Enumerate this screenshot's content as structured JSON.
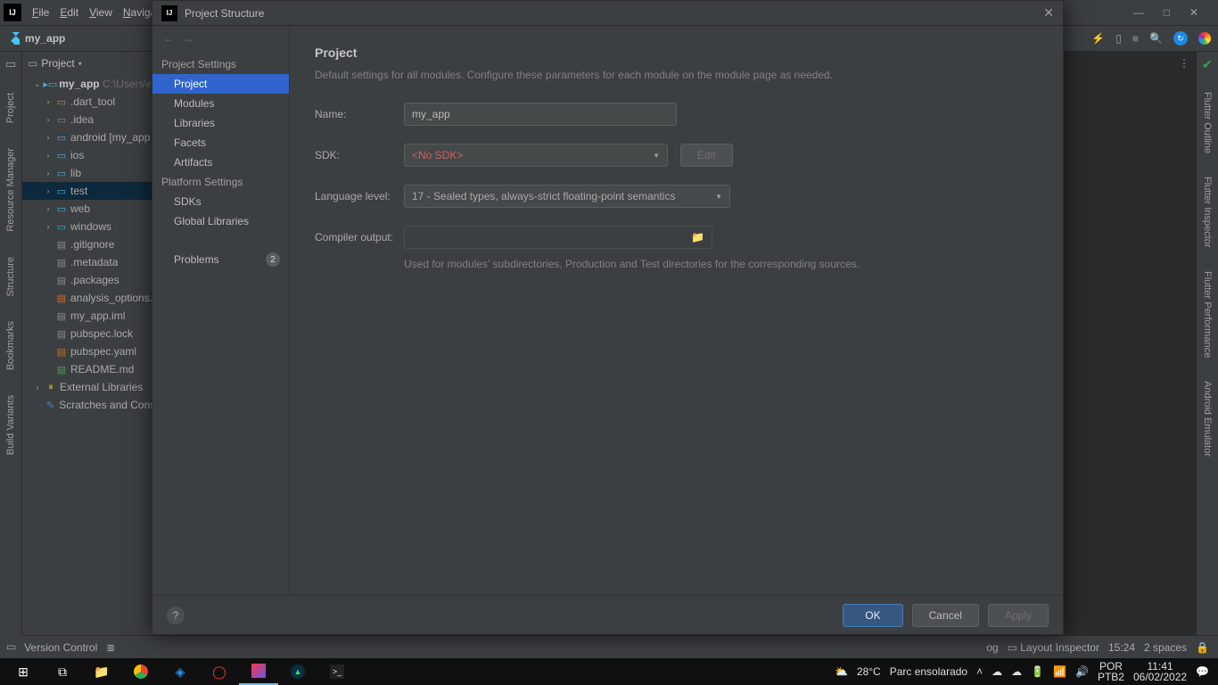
{
  "menubar": {
    "items": [
      "File",
      "Edit",
      "View",
      "Naviga"
    ]
  },
  "win_controls": {
    "min": "—",
    "max": "□",
    "close": "✕"
  },
  "breadcrumb": {
    "project": "my_app"
  },
  "topbar_icons": {
    "bolt": "⚡",
    "phone": "📱",
    "stop": "■",
    "search": "🔍"
  },
  "leftstrip": {
    "tabs": [
      "Project",
      "Resource Manager",
      "Structure",
      "Bookmarks",
      "Build Variants"
    ]
  },
  "rightstrip": {
    "tabs": [
      "Flutter Outline",
      "Flutter Inspector",
      "Flutter Performance",
      "Android Emulator"
    ]
  },
  "project_panel": {
    "title": "Project",
    "root": {
      "name": "my_app",
      "path": "C:\\Users\\en"
    },
    "tree": [
      {
        "indent": 1,
        "arrow": "⌄",
        "icon": "folder-root",
        "label": "my_app",
        "path": " C:\\Users\\en",
        "bold": true
      },
      {
        "indent": 2,
        "arrow": "›",
        "icon": "folder-orange",
        "label": ".dart_tool"
      },
      {
        "indent": 2,
        "arrow": "›",
        "icon": "folder-gray",
        "label": ".idea"
      },
      {
        "indent": 2,
        "arrow": "›",
        "icon": "folder-blue",
        "label": "android [my_app"
      },
      {
        "indent": 2,
        "arrow": "›",
        "icon": "folder-blue",
        "label": "ios"
      },
      {
        "indent": 2,
        "arrow": "›",
        "icon": "folder-blue",
        "label": "lib"
      },
      {
        "indent": 2,
        "arrow": "›",
        "icon": "folder-blue",
        "label": "test",
        "selected": true
      },
      {
        "indent": 2,
        "arrow": "›",
        "icon": "folder-blue",
        "label": "web"
      },
      {
        "indent": 2,
        "arrow": "›",
        "icon": "folder-blue",
        "label": "windows"
      },
      {
        "indent": 2,
        "arrow": "",
        "icon": "file",
        "label": ".gitignore"
      },
      {
        "indent": 2,
        "arrow": "",
        "icon": "file",
        "label": ".metadata"
      },
      {
        "indent": 2,
        "arrow": "",
        "icon": "file",
        "label": ".packages"
      },
      {
        "indent": 2,
        "arrow": "",
        "icon": "file-yaml",
        "label": "analysis_options."
      },
      {
        "indent": 2,
        "arrow": "",
        "icon": "file",
        "label": "my_app.iml"
      },
      {
        "indent": 2,
        "arrow": "",
        "icon": "file",
        "label": "pubspec.lock"
      },
      {
        "indent": 2,
        "arrow": "",
        "icon": "file-yaml",
        "label": "pubspec.yaml"
      },
      {
        "indent": 2,
        "arrow": "",
        "icon": "file-md",
        "label": "README.md"
      },
      {
        "indent": 1,
        "arrow": "›",
        "icon": "lib",
        "label": "External Libraries"
      },
      {
        "indent": 1,
        "arrow": "",
        "icon": "scratch",
        "label": "Scratches and Cons"
      }
    ]
  },
  "dialog": {
    "title": "Project Structure",
    "nav_sections": [
      {
        "title": "Project Settings",
        "items": [
          {
            "label": "Project",
            "selected": true
          },
          {
            "label": "Modules"
          },
          {
            "label": "Libraries"
          },
          {
            "label": "Facets"
          },
          {
            "label": "Artifacts"
          }
        ]
      },
      {
        "title": "Platform Settings",
        "items": [
          {
            "label": "SDKs"
          },
          {
            "label": "Global Libraries"
          }
        ]
      }
    ],
    "problems": {
      "label": "Problems",
      "count": "2"
    },
    "content": {
      "heading": "Project",
      "description": "Default settings for all modules. Configure these parameters for each module on the module page as needed.",
      "name_label": "Name:",
      "name_value": "my_app",
      "sdk_label": "SDK:",
      "sdk_value": "<No SDK>",
      "sdk_edit": "Edit",
      "lang_label": "Language level:",
      "lang_value": "17 - Sealed types, always-strict floating-point semantics",
      "out_label": "Compiler output:",
      "out_value": "",
      "out_hint": "Used for modules' subdirectories, Production and Test directories for the corresponding sources."
    },
    "footer": {
      "help": "?",
      "ok": "OK",
      "cancel": "Cancel",
      "apply": "Apply"
    }
  },
  "statusbar": {
    "vcs": "Version Control",
    "layout": "Layout Inspector",
    "caret": "15:24",
    "indent": "2 spaces",
    "log": "og"
  },
  "taskbar": {
    "weather": {
      "temp": "28°C",
      "desc": "Parc ensolarado"
    },
    "lang": "POR",
    "kbd": "PTB2",
    "time": "11:41",
    "date": "06/02/2022"
  }
}
